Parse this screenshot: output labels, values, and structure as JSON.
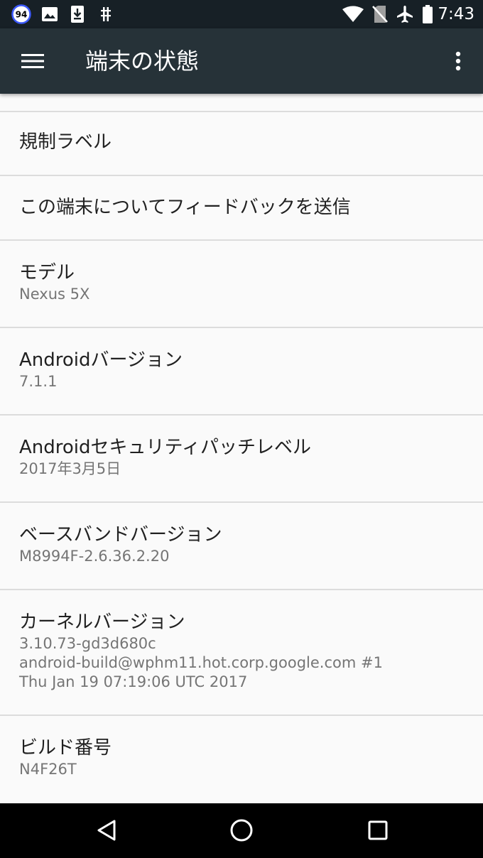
{
  "status_bar": {
    "notification_badge": "94",
    "notification_icons": [
      "image-icon",
      "download-icon",
      "usb-debug-icon"
    ],
    "system_icons": [
      "wifi-icon",
      "no-sim-icon",
      "airplane-mode-icon",
      "battery-icon"
    ],
    "time": "7:43"
  },
  "app_bar": {
    "menu_icon": "hamburger-menu-icon",
    "title": "端末の状態",
    "overflow_icon": "more-vert-icon"
  },
  "items": [
    {
      "title": "規制ラベル"
    },
    {
      "title": "この端末についてフィードバックを送信"
    },
    {
      "title": "モデル",
      "summary": [
        "Nexus 5X"
      ]
    },
    {
      "title": "Androidバージョン",
      "summary": [
        "7.1.1"
      ]
    },
    {
      "title": "Androidセキュリティパッチレベル",
      "summary": [
        "2017年3月5日"
      ]
    },
    {
      "title": "ベースバンドバージョン",
      "summary": [
        "M8994F-2.6.36.2.20"
      ]
    },
    {
      "title": "カーネルバージョン",
      "summary": [
        "3.10.73-gd3d680c",
        "android-build@wphm11.hot.corp.google.com #1",
        "Thu Jan 19 07:19:06 UTC 2017"
      ]
    },
    {
      "title": "ビルド番号",
      "summary": [
        "N4F26T"
      ]
    }
  ],
  "nav_bar": {
    "back_icon": "back-icon",
    "home_icon": "home-icon",
    "recents_icon": "recents-icon"
  },
  "colors": {
    "status_bar": "#172026",
    "app_bar": "#263238",
    "background": "#fafafa",
    "divider": "#dcdcdc",
    "title_text": "#212121",
    "summary_text": "#757575",
    "badge_ring": "#3d5afe"
  }
}
